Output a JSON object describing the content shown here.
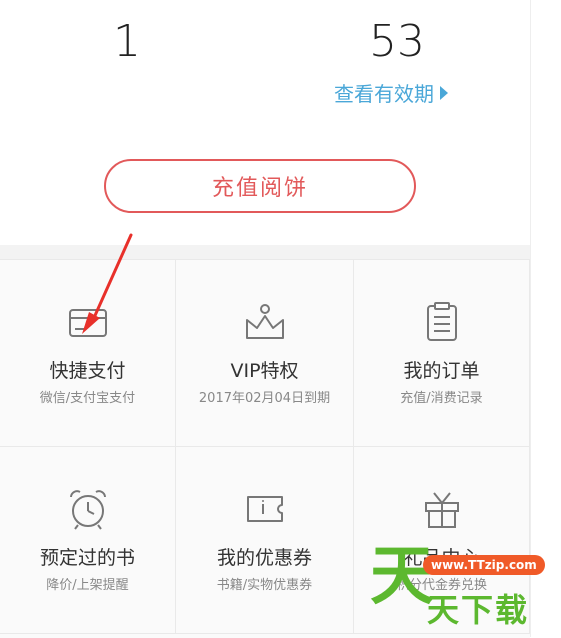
{
  "stats": {
    "first_value": "1",
    "second_value": "53",
    "validity_link": "查看有效期"
  },
  "recharge_button": "充值阅饼",
  "grid": [
    {
      "title": "快捷支付",
      "subtitle": "微信/支付宝支付",
      "icon": "card-icon"
    },
    {
      "title": "VIP特权",
      "subtitle": "2017年02月04日到期",
      "icon": "crown-icon"
    },
    {
      "title": "我的订单",
      "subtitle": "充值/消费记录",
      "icon": "clipboard-icon"
    },
    {
      "title": "预定过的书",
      "subtitle": "降价/上架提醒",
      "icon": "alarm-clock-icon"
    },
    {
      "title": "我的优惠券",
      "subtitle": "书籍/实物优惠券",
      "icon": "ticket-icon"
    },
    {
      "title": "礼品中心",
      "subtitle": "积分代金券兑换",
      "icon": "gift-icon"
    }
  ],
  "watermark": {
    "big": "天",
    "url": "www.TTzip.com",
    "sub": "天下载"
  },
  "colors": {
    "accent_red": "#e2595a",
    "link_blue": "#4aa7d8",
    "watermark_green": "#5cb82f",
    "watermark_orange": "#f05a28"
  }
}
